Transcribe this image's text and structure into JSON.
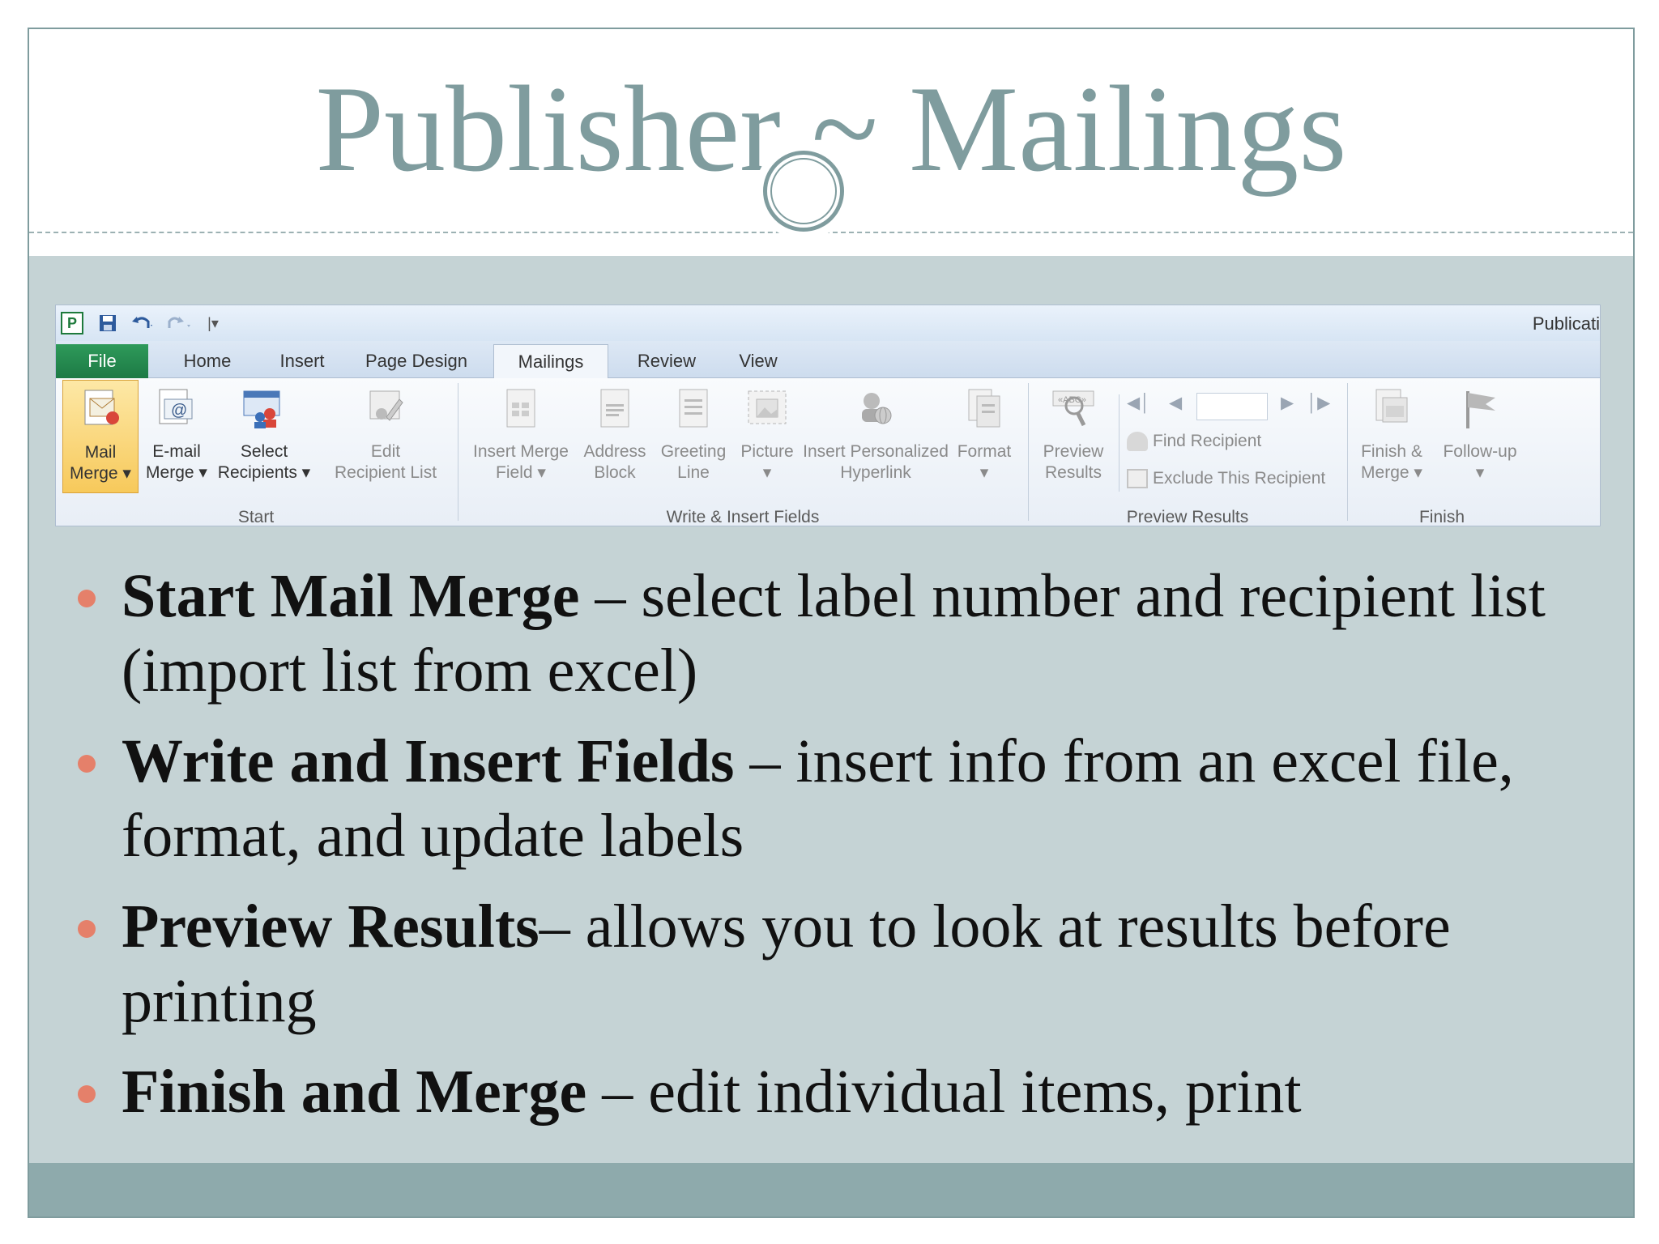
{
  "slide": {
    "title": "Publisher ~ Mailings"
  },
  "ribbon": {
    "window_title": "Publicati",
    "app_icon_letter": "P",
    "tabs": [
      {
        "label": "File"
      },
      {
        "label": "Home"
      },
      {
        "label": "Insert"
      },
      {
        "label": "Page Design"
      },
      {
        "label": "Mailings"
      },
      {
        "label": "Review"
      },
      {
        "label": "View"
      }
    ],
    "active_tab": "Mailings",
    "groups": {
      "start": {
        "label": "Start",
        "buttons": [
          {
            "line1": "Mail",
            "line2": "Merge ▾"
          },
          {
            "line1": "E-mail",
            "line2": "Merge ▾"
          },
          {
            "line1": "Select",
            "line2": "Recipients ▾"
          },
          {
            "line1": "Edit",
            "line2": "Recipient List"
          }
        ]
      },
      "write": {
        "label": "Write & Insert Fields",
        "buttons": [
          {
            "line1": "Insert Merge",
            "line2": "Field ▾"
          },
          {
            "line1": "Address",
            "line2": "Block"
          },
          {
            "line1": "Greeting",
            "line2": "Line"
          },
          {
            "line1": "Picture",
            "line2": "▾"
          },
          {
            "line1": "Insert Personalized",
            "line2": "Hyperlink"
          },
          {
            "line1": "Format",
            "line2": "▾"
          }
        ]
      },
      "preview": {
        "label": "Preview Results",
        "preview_button": {
          "line1": "Preview",
          "line2": "Results"
        },
        "find_recipient": "Find Recipient",
        "exclude_recipient": "Exclude This Recipient"
      },
      "finish": {
        "label": "Finish",
        "buttons": [
          {
            "line1": "Finish &",
            "line2": "Merge ▾"
          },
          {
            "line1": "Follow-up",
            "line2": "▾"
          }
        ]
      }
    }
  },
  "bullets": [
    {
      "bold": "Start Mail Merge",
      "text": " – select label number and recipient list (import list from excel)"
    },
    {
      "bold": "Write and Insert Fields",
      "text": " – insert info from an excel file, format, and update labels"
    },
    {
      "bold": "Preview Results",
      "text": "– allows you to look at results before printing"
    },
    {
      "bold": "Finish and Merge",
      "text": " – edit individual items, print"
    }
  ],
  "colors": {
    "title": "#7f9c9e",
    "body_bg": "#c5d3d5",
    "bottom_band": "#8eaaac",
    "bullet_dot": "#e5806a",
    "file_tab": "#1d7a45",
    "active_button": "#f7c95b"
  }
}
